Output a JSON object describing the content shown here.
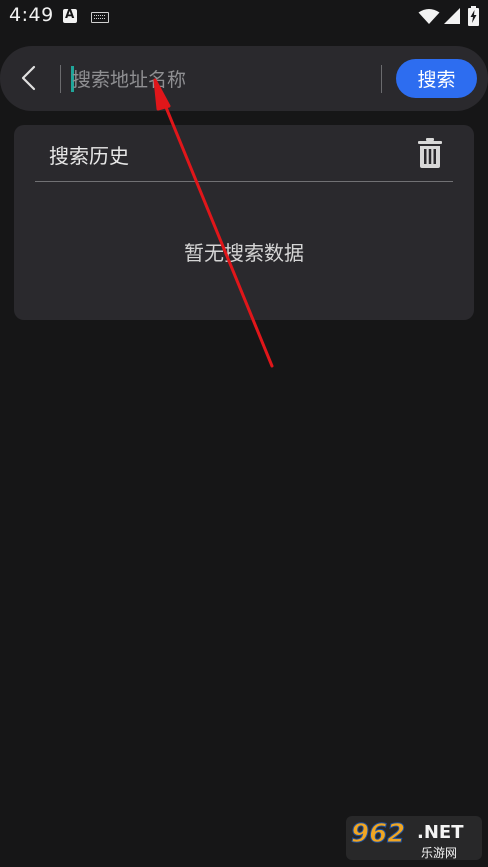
{
  "status_bar": {
    "time": "4:49",
    "icons": [
      "a-notification-icon",
      "keyboard-icon",
      "wifi-icon",
      "signal-icon",
      "battery-charging-icon"
    ]
  },
  "search": {
    "placeholder": "搜索地址名称",
    "value": "",
    "button_label": "搜索",
    "back_icon": "chevron-left-icon",
    "button_color": "#2d6df0"
  },
  "history": {
    "title": "搜索历史",
    "delete_icon": "trash-icon",
    "empty_text": "暂无搜索数据"
  },
  "watermark": {
    "brand_number": "962",
    "brand_suffix": ".NET",
    "brand_cn": "乐游网"
  },
  "colors": {
    "background": "#161617",
    "card": "#2a292d",
    "accent": "#2d6df0",
    "annotation": "#e0161a"
  }
}
